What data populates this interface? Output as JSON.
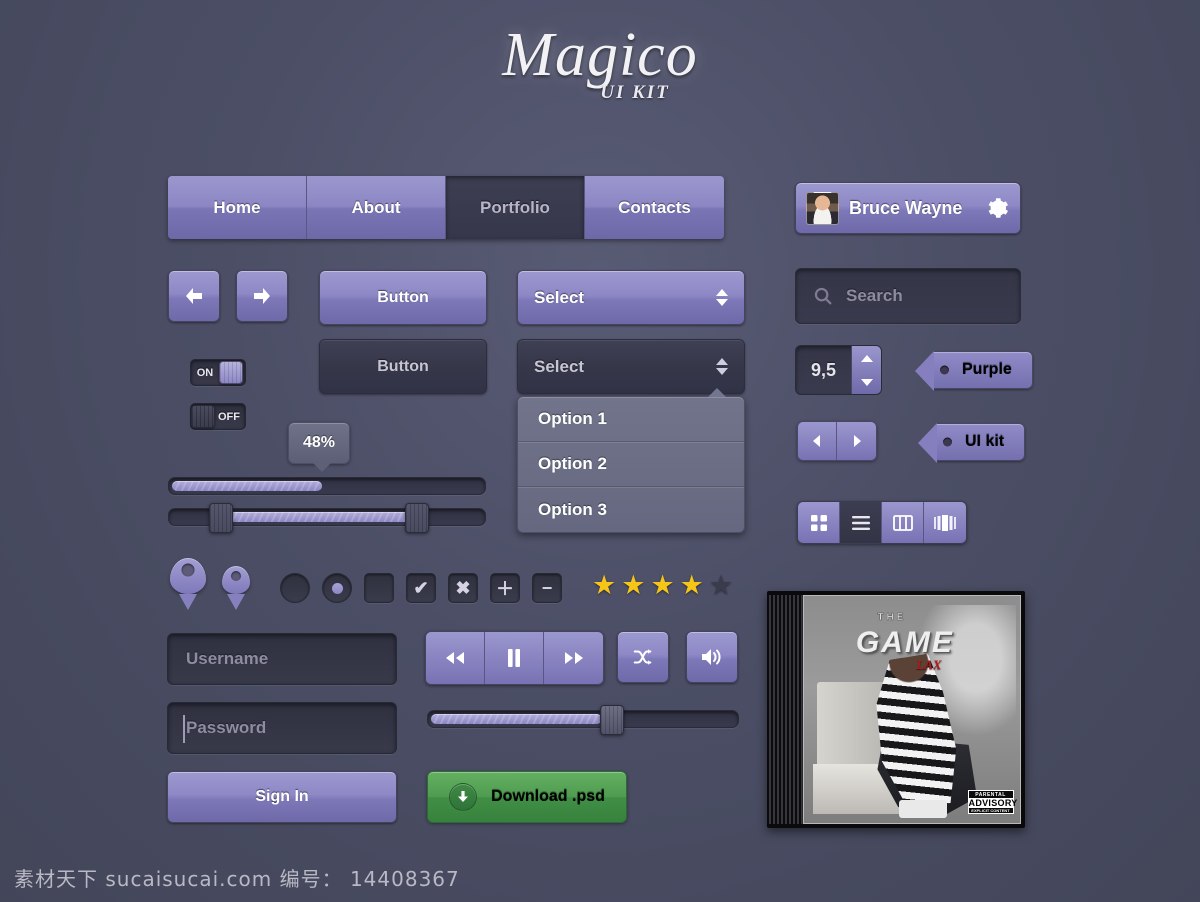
{
  "logo": {
    "title": "Magico",
    "subtitle": "UI KIT"
  },
  "nav": {
    "items": [
      {
        "label": "Home",
        "active": false
      },
      {
        "label": "About",
        "active": false
      },
      {
        "label": "Portfolio",
        "active": true
      },
      {
        "label": "Contacts",
        "active": false
      }
    ]
  },
  "profile": {
    "name": "Bruce Wayne",
    "settings_icon": "gear-icon",
    "avatar_icon": "avatar"
  },
  "search": {
    "placeholder": "Search",
    "icon": "search-icon"
  },
  "buttons": {
    "arrow_left": "arrow-left-icon",
    "arrow_right": "arrow-right-icon",
    "primary_label": "Button",
    "secondary_label": "Button",
    "sign_in": "Sign In",
    "download": "Download .psd",
    "download_icon": "download-icon"
  },
  "selects": {
    "primary_value": "Select",
    "secondary_value": "Select",
    "options": [
      "Option 1",
      "Option 2",
      "Option 3"
    ]
  },
  "toggles": [
    {
      "label": "ON",
      "state": "on"
    },
    {
      "label": "OFF",
      "state": "off"
    }
  ],
  "progress": {
    "tooltip": "48%",
    "percent": 48,
    "range_low": 15,
    "range_high": 77
  },
  "stepper": {
    "value": "9,5",
    "up_icon": "caret-up-icon",
    "down_icon": "caret-down-icon"
  },
  "pager": {
    "prev_icon": "triangle-left-icon",
    "next_icon": "triangle-right-icon"
  },
  "tags": [
    {
      "label": "Purple"
    },
    {
      "label": "UI kit"
    }
  ],
  "view_switch": {
    "items": [
      {
        "icon": "grid-view-icon",
        "active": false
      },
      {
        "icon": "list-view-icon",
        "active": true
      },
      {
        "icon": "column-view-icon",
        "active": false
      },
      {
        "icon": "coverflow-view-icon",
        "active": false
      }
    ]
  },
  "markers": [
    {
      "icon": "map-pin-icon",
      "size": "large"
    },
    {
      "icon": "map-pin-icon",
      "size": "small"
    }
  ],
  "controls": [
    {
      "icon": "radio-unchecked-icon",
      "glyph": ""
    },
    {
      "icon": "radio-checked-icon",
      "glyph": ""
    },
    {
      "icon": "checkbox-unchecked-icon",
      "glyph": ""
    },
    {
      "icon": "checkbox-checked-icon",
      "glyph": "✔"
    },
    {
      "icon": "close-icon",
      "glyph": "✖"
    },
    {
      "icon": "plus-icon",
      "glyph": "＋"
    },
    {
      "icon": "minus-icon",
      "glyph": "−"
    }
  ],
  "rating": {
    "value": 4,
    "max": 5
  },
  "form": {
    "username_placeholder": "Username",
    "password_placeholder": "Password"
  },
  "player": {
    "rewind_icon": "rewind-icon",
    "pause_icon": "pause-icon",
    "forward_icon": "fast-forward-icon",
    "shuffle_icon": "shuffle-icon",
    "volume_icon": "volume-icon",
    "seek_percent": 56
  },
  "album": {
    "line1": "THE",
    "line2": "GAME",
    "line3": "LAX",
    "advisory_top": "PARENTAL",
    "advisory_mid": "ADVISORY",
    "advisory_bottom": "EXPLICIT CONTENT"
  },
  "watermark": {
    "text": "素材天下 sucaisucai.com  编号： 14408367"
  },
  "colors": {
    "background": "#4e5168",
    "purple": "#8c87c4",
    "dark": "#363749",
    "green": "#4f9c51",
    "star": "#f5c518"
  }
}
